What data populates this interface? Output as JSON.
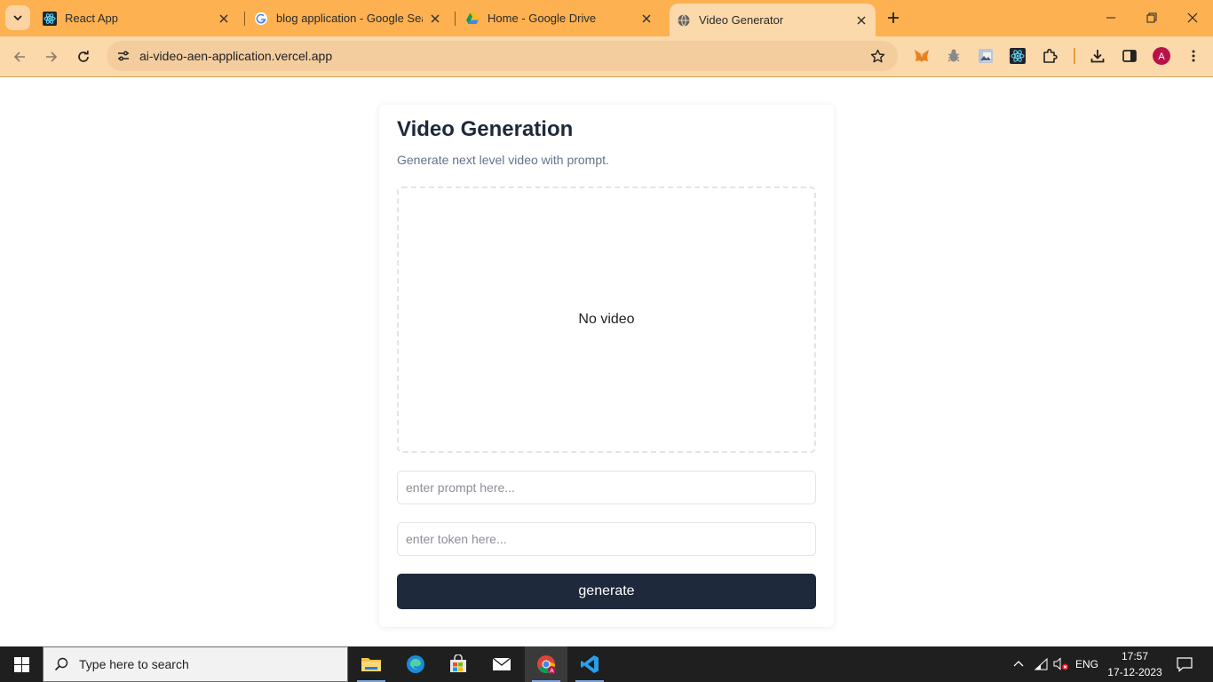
{
  "browser": {
    "tabs": [
      {
        "title": "React App",
        "icon": "react-icon",
        "active": false
      },
      {
        "title": "blog application - Google Search",
        "icon": "google-icon",
        "active": false
      },
      {
        "title": "Home - Google Drive",
        "icon": "google-drive-icon",
        "active": false
      },
      {
        "title": "Video Generator",
        "icon": "globe-icon",
        "active": true
      }
    ],
    "url": "ai-video-aen-application.vercel.app",
    "profile_initial": "A",
    "accent_color": "#fdb151"
  },
  "page": {
    "title": "Video Generation",
    "subtitle": "Generate next level video with prompt.",
    "video_placeholder": "No video",
    "prompt_placeholder": "enter prompt here...",
    "token_placeholder": "enter token here...",
    "generate_label": "generate",
    "button_color": "#1e293b"
  },
  "taskbar": {
    "search_placeholder": "Type here to search",
    "language": "ENG",
    "time": "17:57",
    "date": "17-12-2023"
  }
}
